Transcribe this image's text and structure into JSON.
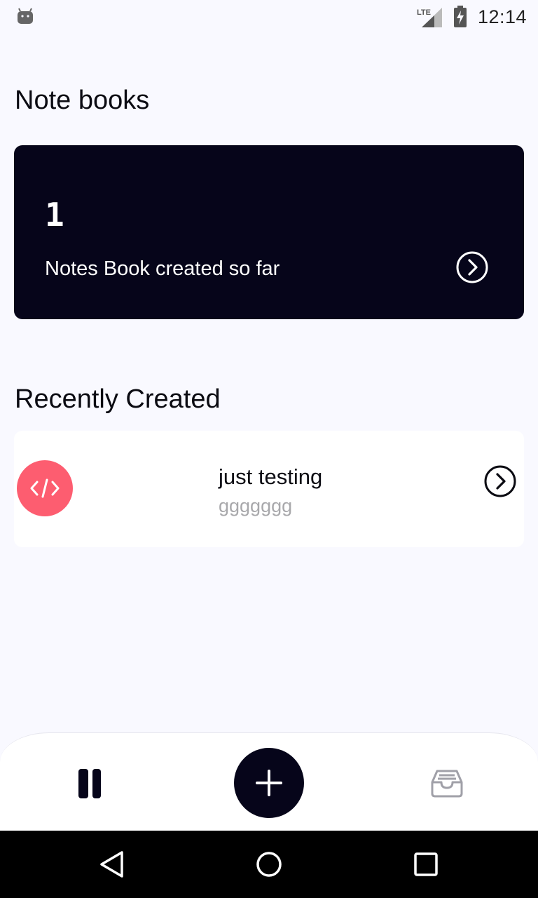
{
  "status_bar": {
    "time": "12:14",
    "network_label": "LTE",
    "icons": [
      "android-icon",
      "lte-signal-icon",
      "battery-charging-icon"
    ]
  },
  "notebooks_section": {
    "title": "Note books"
  },
  "summary_card": {
    "count": "1",
    "label": "Notes Book created so far",
    "icon": "chevron-right-circle-icon"
  },
  "recent_section": {
    "title": "Recently Created",
    "items": [
      {
        "title": "just testing",
        "subtitle": "ggggggg",
        "avatar_icon": "code-icon",
        "avatar_color": "#fd5d70",
        "arrow_icon": "chevron-right-circle-icon"
      }
    ]
  },
  "bottom_nav": {
    "left_icon": "notebooks-icon",
    "fab_icon": "plus-icon",
    "right_icon": "archive-inbox-icon"
  },
  "system_nav": {
    "icons": [
      "back-icon",
      "home-icon",
      "recents-icon"
    ]
  },
  "colors": {
    "background": "#f9f9ff",
    "card_dark": "#06051a",
    "accent": "#fd5d70",
    "muted_text": "#a8a8ab"
  }
}
